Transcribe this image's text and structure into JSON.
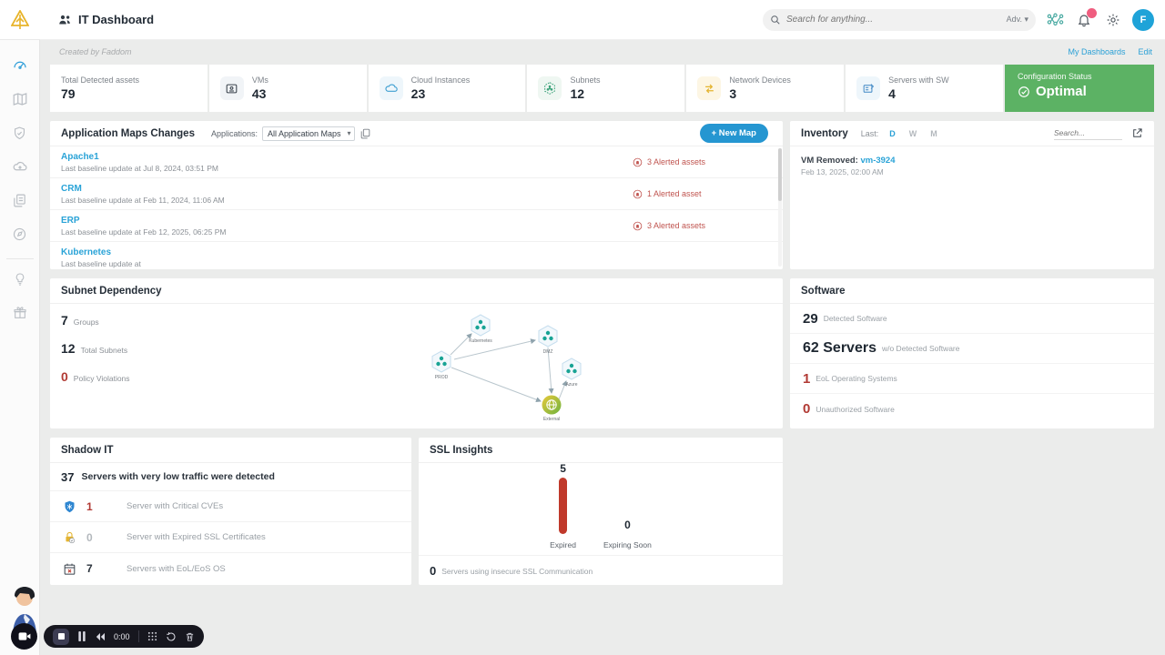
{
  "app": {
    "title": "IT Dashboard",
    "created_by": "Created by Faddom",
    "my_dashboards": "My Dashboards",
    "edit": "Edit"
  },
  "search": {
    "placeholder": "Search for anything...",
    "adv": "Adv."
  },
  "user": {
    "initial": "F"
  },
  "stats": [
    {
      "label": "Total Detected assets",
      "value": "79",
      "icon": ""
    },
    {
      "label": "VMs",
      "value": "43",
      "icon": "vm-icon"
    },
    {
      "label": "Cloud Instances",
      "value": "23",
      "icon": "cloud-icon"
    },
    {
      "label": "Subnets",
      "value": "12",
      "icon": "subnet-icon"
    },
    {
      "label": "Network Devices",
      "value": "3",
      "icon": "network-arrows-icon"
    },
    {
      "label": "Servers with SW",
      "value": "4",
      "icon": "server-sw-icon"
    }
  ],
  "config_status": {
    "label": "Configuration Status",
    "value": "Optimal",
    "color": "#5cb264"
  },
  "app_maps": {
    "title": "Application Maps Changes",
    "applications_label": "Applications:",
    "applications_value": "All Application Maps",
    "new_map_label": "+ New Map",
    "items": [
      {
        "name": "Apache1",
        "updated": "Last baseline update at Jul 8, 2024, 03:51 PM",
        "alert": "3 Alerted assets"
      },
      {
        "name": "CRM",
        "updated": "Last baseline update at Feb 11, 2024, 11:06 AM",
        "alert": "1 Alerted asset"
      },
      {
        "name": "ERP",
        "updated": "Last baseline update at Feb 12, 2025, 06:25 PM",
        "alert": "3 Alerted assets"
      },
      {
        "name": "Kubernetes",
        "updated": "Last baseline update at",
        "alert": ""
      }
    ]
  },
  "inventory": {
    "title": "Inventory",
    "last_label": "Last:",
    "periods": [
      "D",
      "W",
      "M"
    ],
    "search_placeholder": "Search...",
    "event_label": "VM Removed:",
    "event_value": "vm-3924",
    "event_time": "Feb 13, 2025, 02:00 AM"
  },
  "subnet": {
    "title": "Subnet Dependency",
    "stats": [
      {
        "value": "7",
        "label": "Groups"
      },
      {
        "value": "12",
        "label": "Total Subnets"
      },
      {
        "value": "0",
        "label": "Policy Violations"
      }
    ],
    "nodes": [
      "Kubernetes",
      "DMZ",
      "PROD",
      "Azure",
      "External"
    ]
  },
  "software": {
    "title": "Software",
    "rows": [
      {
        "value": "29",
        "label": "Detected Software"
      },
      {
        "value": "62 Servers",
        "label": "w/o Detected Software"
      },
      {
        "value": "1",
        "label": "EoL Operating Systems"
      },
      {
        "value": "0",
        "label": "Unauthorized Software"
      }
    ]
  },
  "shadow_it": {
    "title": "Shadow IT",
    "headline_value": "37",
    "headline": "Servers with very low traffic were detected",
    "rows": [
      {
        "icon": "shield-cve-icon",
        "value": "1",
        "label": "Server with Critical CVEs"
      },
      {
        "icon": "lock-icon",
        "value": "0",
        "label": "Server with Expired SSL Certificates"
      },
      {
        "icon": "calendar-x-icon",
        "value": "7",
        "label": "Servers with EoL/EoS OS"
      }
    ]
  },
  "ssl": {
    "title": "SSL Insights",
    "footer_value": "0",
    "footer_label": "Servers using insecure SSL Communication"
  },
  "chart_data": {
    "type": "bar",
    "title": "SSL Insights",
    "categories": [
      "Expired",
      "Expiring Soon"
    ],
    "values": [
      5,
      0
    ],
    "ylim": [
      0,
      5
    ],
    "bar_color": "#c0392b",
    "grid": false,
    "legend": false
  },
  "recorder": {
    "time": "0:00"
  }
}
